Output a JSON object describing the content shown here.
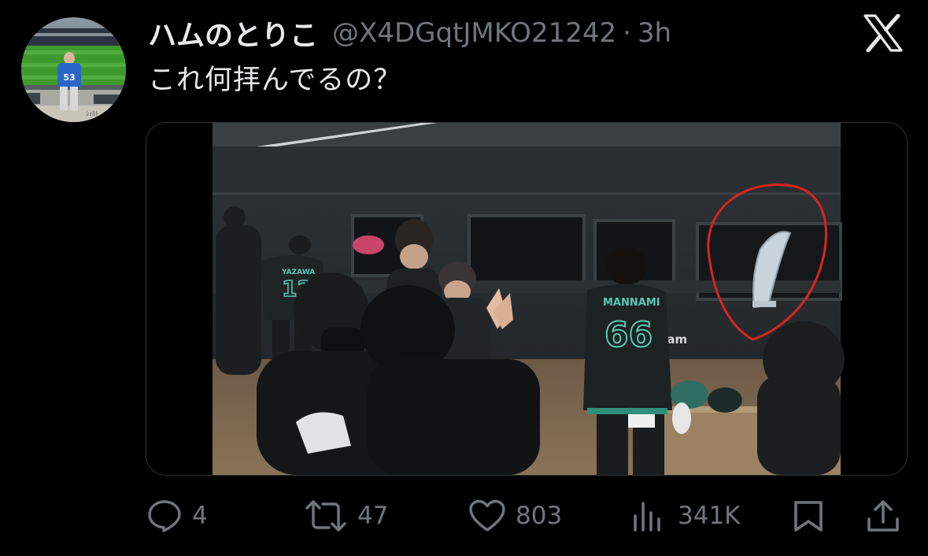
{
  "tweet": {
    "author": {
      "display_name": "ハムのとりこ",
      "handle": "@X4DGqtJMKO21242",
      "separator": "·",
      "time": "3h",
      "avatar": {
        "jersey_number": "53",
        "caption": "ｼｪﾙﾄ"
      }
    },
    "text": "これ何拝んでるの？",
    "media": {
      "dugout_signage": "nham",
      "players": [
        {
          "name": "YAZAWA",
          "number": "12"
        },
        {
          "name": "MANNAMI",
          "number": "66"
        }
      ]
    },
    "actions": {
      "reply_count": "4",
      "retweet_count": "47",
      "like_count": "803",
      "view_count": "341K"
    }
  },
  "icons": {
    "platform_logo": "x-logo-icon",
    "reply": "speech-bubble-icon",
    "retweet": "retweet-arrows-icon",
    "like": "heart-icon",
    "views": "bar-chart-icon",
    "bookmark": "bookmark-icon",
    "share": "share-upload-icon"
  },
  "colors": {
    "background": "#000000",
    "text_primary": "#e7e9ea",
    "text_secondary": "#71767b",
    "annotation_circle": "#d9261c",
    "jersey_number_teal": "#5ac8b4"
  }
}
